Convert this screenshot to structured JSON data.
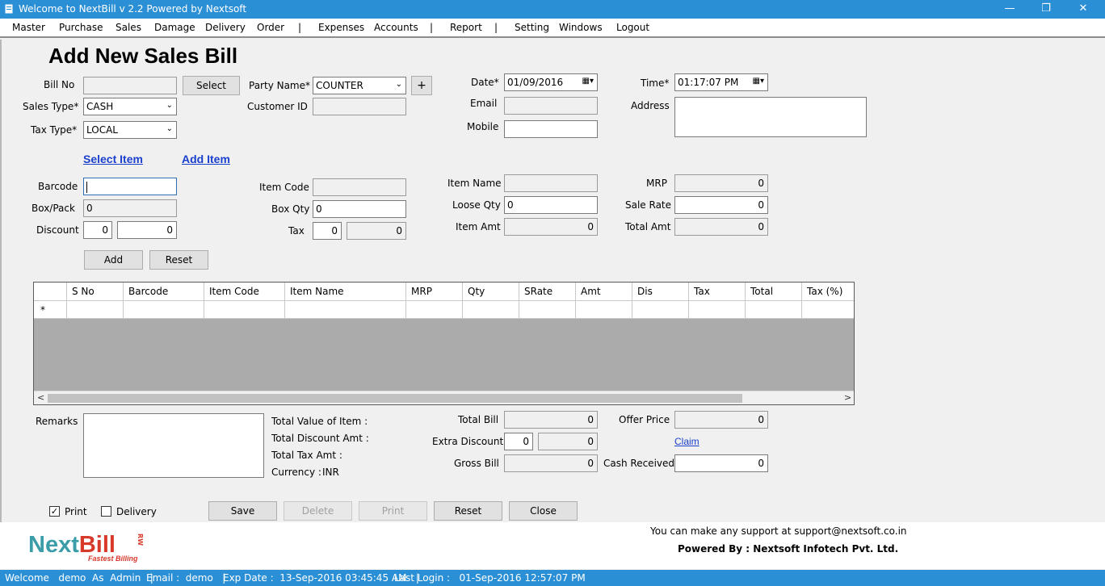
{
  "window": {
    "title": "Welcome to NextBill v 2.2 Powered by Nextsoft",
    "minimize": "—",
    "restore": "❐",
    "close": "✕"
  },
  "menu": [
    "Master",
    "Purchase",
    "Sales",
    "Damage",
    "Delivery",
    "Order",
    "|",
    "Expenses",
    "Accounts",
    "|",
    "Report",
    "|",
    "Setting",
    "Windows",
    "Logout"
  ],
  "page_title": "Add New Sales Bill",
  "header": {
    "bill_no_label": "Bill No",
    "bill_no_value": "",
    "select_button": "Select",
    "sales_type_label": "Sales Type*",
    "sales_type_value": "CASH",
    "tax_type_label": "Tax Type*",
    "tax_type_value": "LOCAL",
    "party_name_label": "Party Name*",
    "party_name_value": "COUNTER",
    "add_party_button": "+",
    "customer_id_label": "Customer ID",
    "customer_id_value": "",
    "date_label": "Date*",
    "date_value": "01/09/2016",
    "email_label": "Email",
    "email_value": "",
    "mobile_label": "Mobile",
    "mobile_value": "",
    "time_label": "Time*",
    "time_value": "01:17:07 PM",
    "address_label": "Address",
    "address_value": ""
  },
  "links": {
    "select_item": "Select Item",
    "add_item": "Add Item",
    "claim": "Claim"
  },
  "item": {
    "barcode_label": "Barcode",
    "barcode_value": "",
    "box_pack_label": "Box/Pack",
    "box_pack_value": "0",
    "discount_label": "Discount",
    "discount_pct": "0",
    "discount_amt": "0",
    "item_code_label": "Item Code",
    "item_code_value": "",
    "box_qty_label": "Box Qty",
    "box_qty_value": "0",
    "tax_label": "Tax",
    "tax_pct": "0",
    "tax_amt": "0",
    "item_name_label": "Item Name",
    "item_name_value": "",
    "loose_qty_label": "Loose Qty",
    "loose_qty_value": "0",
    "item_amt_label": "Item Amt",
    "item_amt_value": "0",
    "mrp_label": "MRP",
    "mrp_value": "0",
    "sale_rate_label": "Sale Rate",
    "sale_rate_value": "0",
    "total_amt_label": "Total Amt",
    "total_amt_value": "0",
    "add_button": "Add",
    "reset_button": "Reset"
  },
  "grid": {
    "columns": [
      "S No",
      "Barcode",
      "Item Code",
      "Item Name",
      "MRP",
      "Qty",
      "SRate",
      "Amt",
      "Dis",
      "Tax",
      "Total",
      "Tax (%)"
    ],
    "new_row_marker": "*",
    "scroll_left": "<",
    "scroll_right": ">"
  },
  "summary": {
    "remarks_label": "Remarks",
    "total_value_label": "Total Value of Item :",
    "total_discount_label": "Total Discount Amt :",
    "total_tax_label": "Total Tax Amt :",
    "currency_label": "Currency :",
    "currency_value": "INR",
    "total_bill_label": "Total Bill",
    "total_bill_value": "0",
    "extra_discount_label": "Extra Discount",
    "extra_discount_pct": "0",
    "extra_discount_amt": "0",
    "gross_bill_label": "Gross Bill",
    "gross_bill_value": "0",
    "offer_price_label": "Offer Price",
    "offer_price_value": "0",
    "cash_received_label": "Cash Received",
    "cash_received_value": "0"
  },
  "actions": {
    "print_check_label": "Print",
    "print_checked": "✓",
    "delivery_check_label": "Delivery",
    "save": "Save",
    "delete": "Delete",
    "print": "Print",
    "reset": "Reset",
    "close": "Close"
  },
  "footer": {
    "logo_next": "Next",
    "logo_bill": "Bill",
    "logo_rw": "RW",
    "logo_tagline": "Fastest Billing",
    "support": "You can make any support at support@nextsoft.co.in",
    "powered_by": "Powered By : Nextsoft Infotech Pvt. Ltd."
  },
  "status": {
    "welcome": "Welcome   demo  As  Admin   |",
    "email": "Email :  demo   |",
    "exp": "Exp Date :  13-Sep-2016 03:45:45 AM   |",
    "last_login": "Last Login :   01-Sep-2016 12:57:07 PM"
  }
}
